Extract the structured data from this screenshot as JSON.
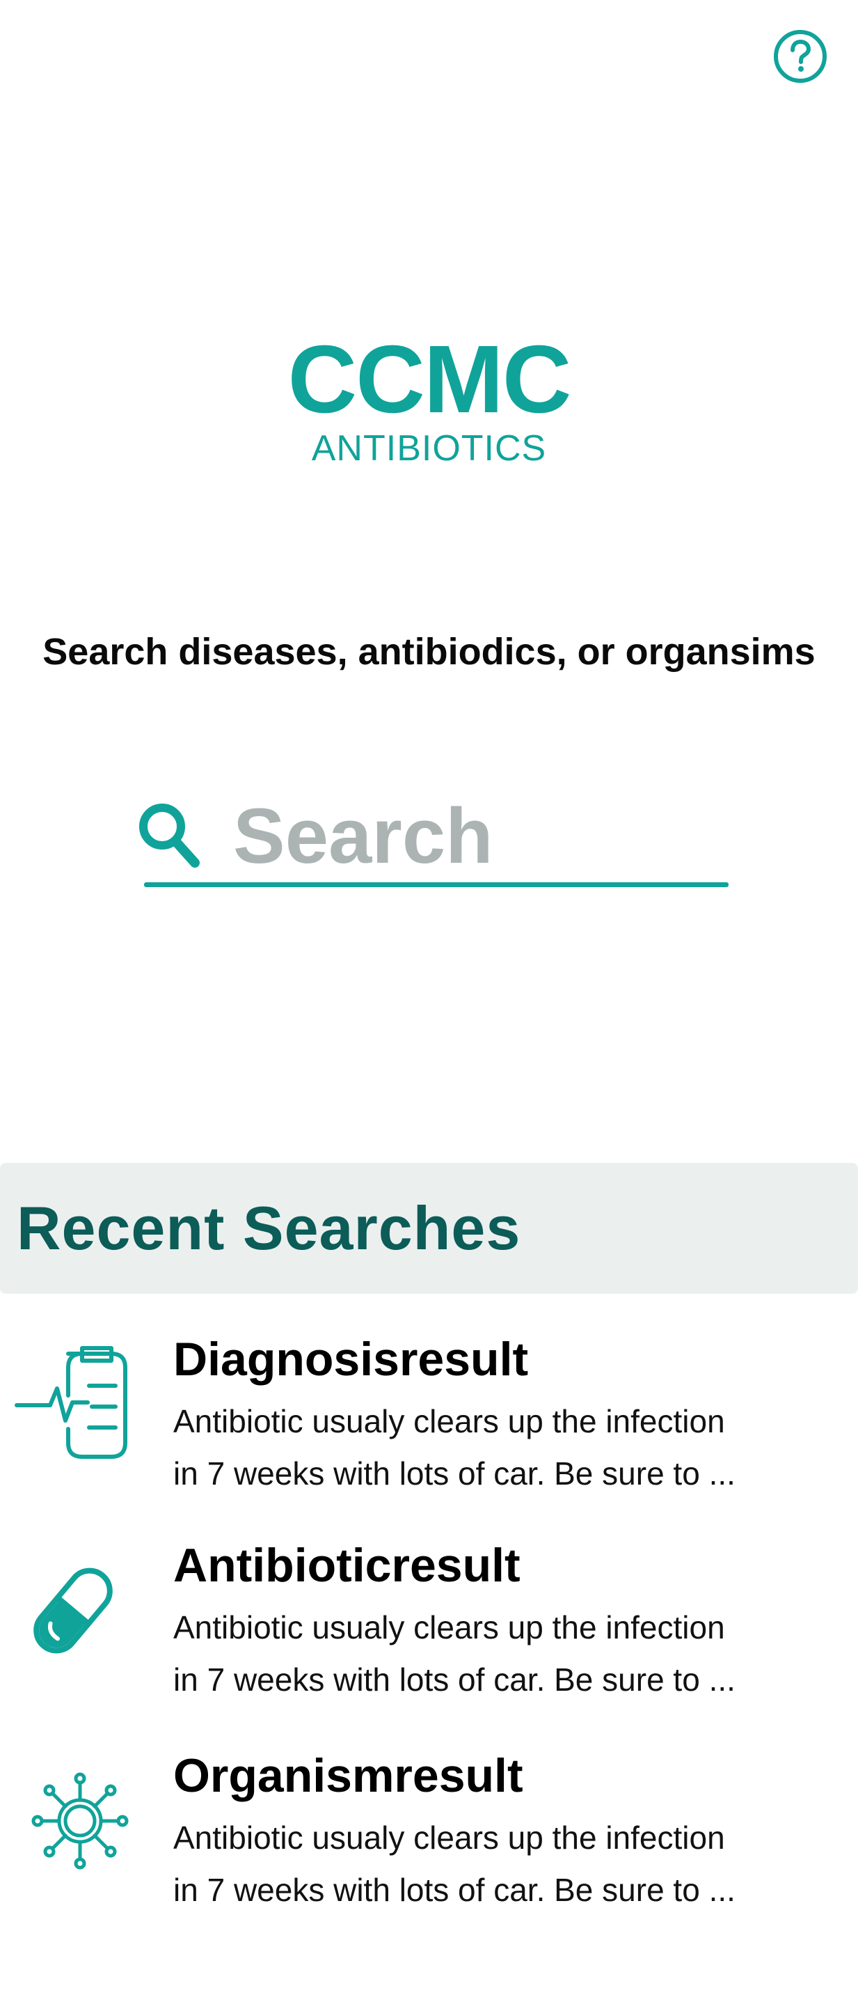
{
  "header": {
    "help_icon": "question-circle-icon"
  },
  "logo": {
    "title": "CCMC",
    "subtitle": "ANTIBIOTICS"
  },
  "search": {
    "prompt": "Search diseases, antibiodics, or organsims",
    "placeholder": "Search",
    "value": "",
    "icon": "search-icon"
  },
  "recent": {
    "title": "Recent Searches",
    "items": [
      {
        "icon": "diagnosis-clipboard-icon",
        "title": "Diagnosisresult",
        "desc_line1": "Antibiotic usualy clears up the infection",
        "desc_line2": "in 7 weeks with lots of car. Be sure to ..."
      },
      {
        "icon": "pill-capsule-icon",
        "title": "Antibioticresult",
        "desc_line1": "Antibiotic usualy clears up the infection",
        "desc_line2": "in 7 weeks with lots of car. Be sure to ..."
      },
      {
        "icon": "virus-organism-icon",
        "title": "Organismresult",
        "desc_line1": "Antibiotic usualy clears up the infection",
        "desc_line2": "in 7 weeks with lots of car. Be sure to ..."
      }
    ]
  },
  "colors": {
    "accent": "#10a39a",
    "header_text": "#0c5c58",
    "header_bg": "#ebf0ef",
    "placeholder": "#acb4b3"
  }
}
